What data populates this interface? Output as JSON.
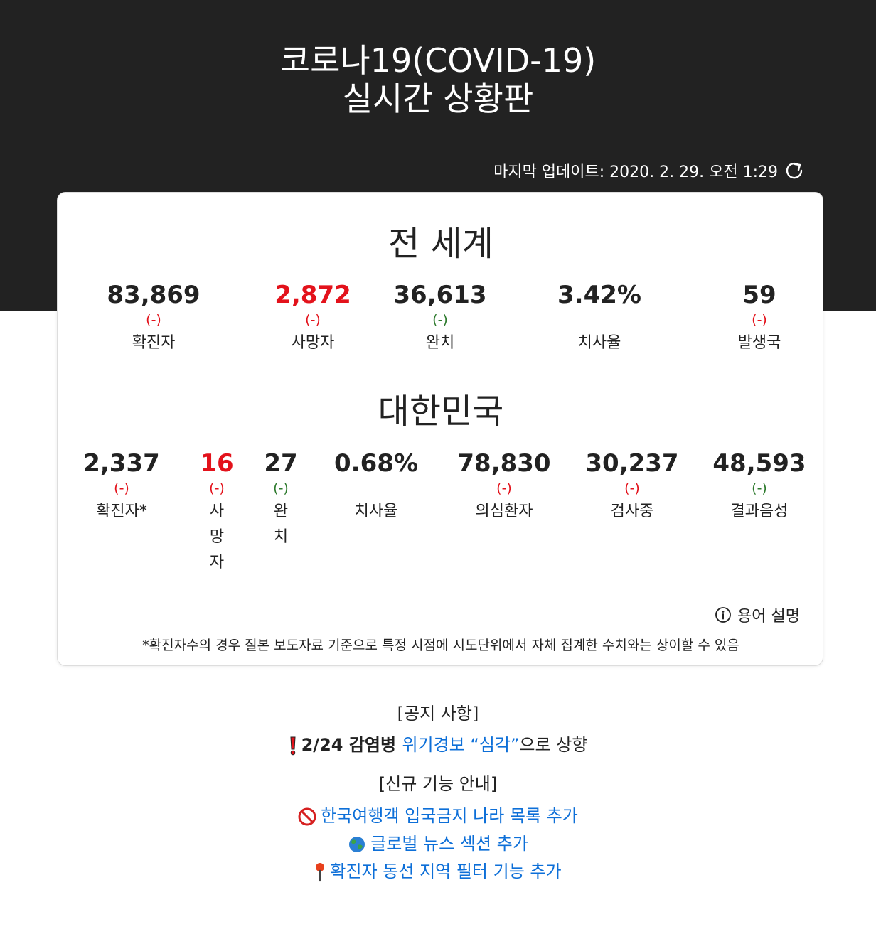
{
  "header": {
    "title_line1": "코로나19(COVID-19)",
    "title_line2": "실시간 상황판",
    "last_update_label": "마지막 업데이트: 2020. 2. 29. 오전 1:29",
    "refresh_icon": "refresh-icon"
  },
  "world": {
    "title": "전 세계",
    "stats": [
      {
        "value": "83,869",
        "delta": "(-)",
        "label": "확진자"
      },
      {
        "value": "2,872",
        "delta": "(-)",
        "label": "사망자"
      },
      {
        "value": "36,613",
        "delta": "(-)",
        "label": "완치"
      },
      {
        "value": "3.42%",
        "delta": "",
        "label": "치사율"
      },
      {
        "value": "59",
        "delta": "(-)",
        "label": "발생국"
      }
    ]
  },
  "korea": {
    "title": "대한민국",
    "stats": [
      {
        "value": "2,337",
        "delta": "(-)",
        "label": "확진자*"
      },
      {
        "value": "16",
        "delta": "(-)",
        "label": "사망자"
      },
      {
        "value": "27",
        "delta": "(-)",
        "label": "완치"
      },
      {
        "value": "0.68%",
        "delta": "",
        "label": "치사율"
      },
      {
        "value": "78,830",
        "delta": "(-)",
        "label": "의심환자"
      },
      {
        "value": "30,237",
        "delta": "(-)",
        "label": "검사중"
      },
      {
        "value": "48,593",
        "delta": "(-)",
        "label": "결과음성"
      }
    ]
  },
  "glossary": {
    "label": "용어 설명",
    "icon": "info-icon"
  },
  "footnote": "*확진자수의 경우 질본 보도자료 기준으로 특정 시점에 시도단위에서 자체 집계한 수치와는 상이할 수 있음",
  "notice": {
    "heading": "[공지 사항]",
    "item_prefix": "2/24 감염병 ",
    "item_link": "위기경보 “심각”",
    "item_suffix": "으로 상향"
  },
  "features": {
    "heading": "[신규 기능 안내]",
    "items": [
      {
        "icon": "prohibited-icon",
        "label": "한국여행객 입국금지 나라 목록 추가"
      },
      {
        "icon": "globe-icon",
        "label": "글로벌 뉴스 섹션 추가"
      },
      {
        "icon": "pin-icon",
        "label": "확진자 동선 지역 필터 기능 추가"
      }
    ]
  },
  "colors": {
    "dark_bg": "#222222",
    "red": "#e3121b",
    "green": "#2d7a2d",
    "link": "#0d6fd8"
  }
}
